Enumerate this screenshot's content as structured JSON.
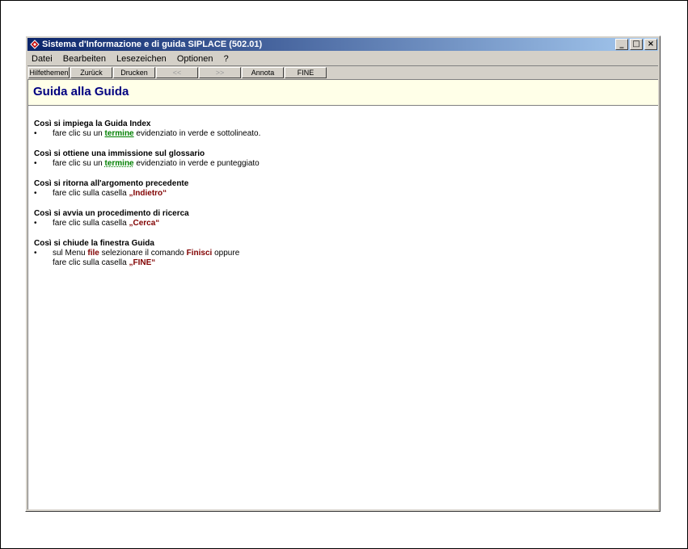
{
  "window": {
    "title": "Sistema d'Informazione e di guida SIPLACE (502.01)",
    "controls": {
      "minimize": "_",
      "maximize": "□",
      "close": "×"
    }
  },
  "menubar": [
    "Datei",
    "Bearbeiten",
    "Lesezeichen",
    "Optionen",
    "?"
  ],
  "toolbar": [
    {
      "label": "Hilfethemen",
      "enabled": true
    },
    {
      "label": "Zurück",
      "enabled": true
    },
    {
      "label": "Drucken",
      "enabled": true
    },
    {
      "label": "<<",
      "enabled": false
    },
    {
      "label": ">>",
      "enabled": false
    },
    {
      "label": "Annota",
      "enabled": true
    },
    {
      "label": "FINE",
      "enabled": true
    }
  ],
  "page": {
    "title": "Guida alla Guida",
    "sections": [
      {
        "heading": "Così si impiega la Guida Index",
        "bullet": "•",
        "pre": "fare clic su un ",
        "term": "termine",
        "post": " evidenziato in verde e sottolineato."
      },
      {
        "heading": "Così si ottiene una immissione sul glossario",
        "bullet": "•",
        "pre": "fare clic su un ",
        "term": "termine",
        "post": " evidenziato in verde e punteggiato"
      },
      {
        "heading": "Così si ritorna all'argomento precedente",
        "bullet": "•",
        "pre": "fare clic sulla casella ",
        "term": "„Indietro“"
      },
      {
        "heading": "Così si avvia un procedimento di ricerca",
        "bullet": "•",
        "pre": "fare clic sulla casella ",
        "term": "„Cerca“"
      },
      {
        "heading": "Così si chiude la finestra Guida",
        "bullet": "•",
        "pre": "sul Menu ",
        "term": "file",
        "mid": " selezionare il comando ",
        "term2": "Finisci",
        "post": " oppure",
        "line2_pre": "fare clic sulla casella ",
        "line2_term": "„FINE“"
      }
    ]
  },
  "colors": {
    "title_gradient_start": "#0a246a",
    "title_gradient_end": "#a6caf0",
    "header_band": "#ffffe8",
    "page_title": "#000080",
    "term_green": "#008000",
    "term_red": "#800000"
  },
  "icons": {
    "app_icon": "siplace-app-icon"
  }
}
